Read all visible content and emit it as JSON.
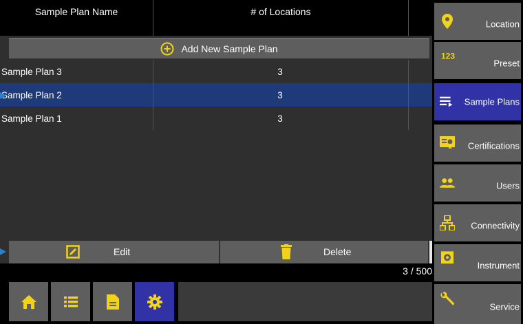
{
  "table": {
    "headers": [
      "Sample Plan Name",
      "# of Locations"
    ],
    "add_label": "Add New Sample Plan",
    "rows": [
      {
        "name": "Sample Plan 3",
        "locations": "3"
      },
      {
        "name": "Sample Plan 2",
        "locations": "3"
      },
      {
        "name": "Sample Plan 1",
        "locations": "3"
      }
    ]
  },
  "actions": {
    "edit_label": "Edit",
    "delete_label": "Delete"
  },
  "count": "3 / 500",
  "bottom_nav": [
    {
      "icon": "home-icon"
    },
    {
      "icon": "list-icon"
    },
    {
      "icon": "document-icon"
    },
    {
      "icon": "gear-icon",
      "active": true
    }
  ],
  "side_menu": [
    {
      "label": "Location",
      "icon": "location-pin-icon"
    },
    {
      "label": "Preset",
      "icon": "numbers-123-icon"
    },
    {
      "label": "Sample Plans",
      "icon": "playlist-icon",
      "active": true
    },
    {
      "label": "Certifications",
      "icon": "certificate-icon"
    },
    {
      "label": "Users",
      "icon": "users-icon"
    },
    {
      "label": "Connectivity",
      "icon": "network-icon"
    },
    {
      "label": "Instrument",
      "icon": "instrument-icon"
    },
    {
      "label": "Service",
      "icon": "wrench-icon"
    }
  ],
  "colors": {
    "accent_yellow": "#f2d31b",
    "active_blue": "#3032a6",
    "selected_row": "#1e3a78",
    "button_gray": "#5e5e5e"
  }
}
